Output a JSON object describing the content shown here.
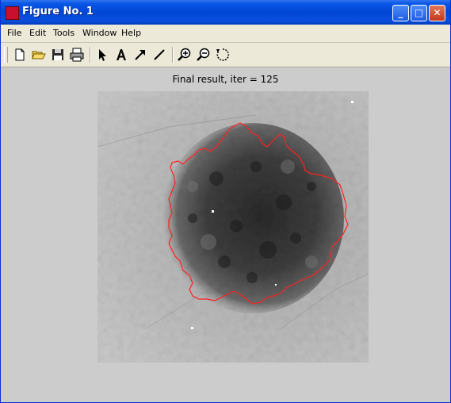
{
  "window": {
    "title": "Figure No. 1",
    "controls": {
      "minimize": "_",
      "maximize": "□",
      "close": "✕"
    }
  },
  "menu": {
    "items": [
      "File",
      "Edit",
      "Tools",
      "Window",
      "Help"
    ]
  },
  "toolbar": {
    "tools": [
      "new-figure-icon",
      "open-file-icon",
      "save-icon",
      "print-icon",
      "select-arrow-icon",
      "insert-text-icon",
      "insert-arrow-icon",
      "insert-line-icon",
      "zoom-in-icon",
      "zoom-out-icon",
      "rotate-icon"
    ]
  },
  "axes": {
    "title": "Final result,  iter = 125"
  },
  "colors": {
    "contour": "#ff2020",
    "figure_bg": "#cccccc",
    "titlebar": "#0046d5"
  }
}
